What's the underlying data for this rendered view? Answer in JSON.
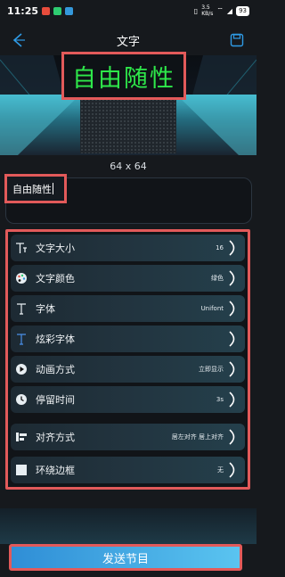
{
  "status_bar": {
    "time": "11:25",
    "network_speed_value": "3.5",
    "network_speed_unit": "KB/s",
    "battery": "93"
  },
  "header": {
    "title": "文字"
  },
  "preview": {
    "led_text": "自由随性",
    "resolution": "64 x 64"
  },
  "text_input": {
    "value": "自由随性"
  },
  "settings": [
    {
      "label": "文字大小",
      "value": "16",
      "icon": "text-size-icon"
    },
    {
      "label": "文字颜色",
      "value": "绿色",
      "icon": "palette-icon"
    },
    {
      "label": "字体",
      "value": "Unifont",
      "icon": "font-icon"
    },
    {
      "label": "炫彩字体",
      "value": "",
      "icon": "color-font-icon"
    },
    {
      "label": "动画方式",
      "value": "立即显示",
      "icon": "play-icon"
    },
    {
      "label": "停留时间",
      "value": "3s",
      "icon": "clock-icon"
    },
    {
      "label": "对齐方式",
      "value": "居左对齐  居上对齐",
      "icon": "align-icon"
    },
    {
      "label": "环绕边框",
      "value": "无",
      "icon": "border-icon"
    }
  ],
  "send_button": {
    "label": "发送节目"
  },
  "colors": {
    "accent": "#e25a5a",
    "led_green": "#2ee84a",
    "send_blue": "#4aaee8"
  }
}
